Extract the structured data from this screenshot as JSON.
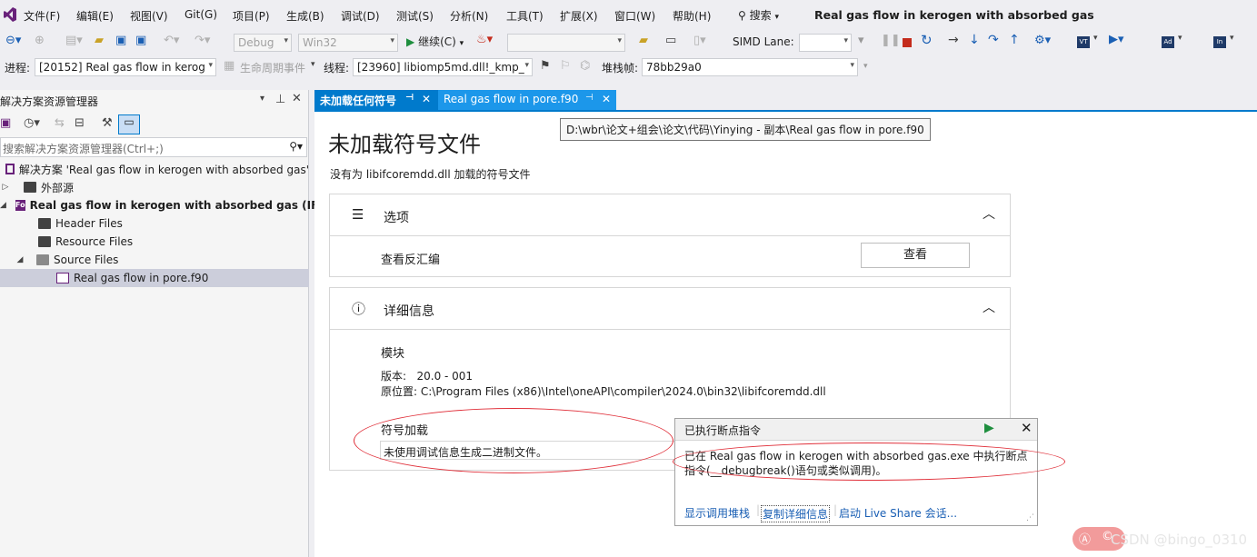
{
  "menu": {
    "items": [
      "文件(F)",
      "编辑(E)",
      "视图(V)",
      "Git(G)",
      "项目(P)",
      "生成(B)",
      "调试(D)",
      "测试(S)",
      "分析(N)",
      "工具(T)",
      "扩展(X)",
      "窗口(W)",
      "帮助(H)"
    ],
    "search_label": "搜索",
    "window_title": "Real gas flow in kerogen with absorbed gas"
  },
  "toolbar1": {
    "config": "Debug",
    "platform": "Win32",
    "continue_label": "继续(C)",
    "simd_label": "SIMD Lane:"
  },
  "toolbar2": {
    "process_label": "进程:",
    "process_value": "[20152] Real gas flow in kerog",
    "lifecycle_label": "生命周期事件",
    "thread_label": "线程:",
    "thread_value": "[23960] libiomp5md.dll!_kmp_",
    "stackframe_label": "堆栈帧:",
    "stackframe_value": "78bb29a0"
  },
  "solution_explorer": {
    "title": "解决方案资源管理器",
    "search_placeholder": "搜索解决方案资源管理器(Ctrl+;)",
    "items": [
      {
        "label": "解决方案 'Real gas flow in kerogen with absorbed gas'"
      },
      {
        "label": "外部源"
      },
      {
        "label": "Real gas flow in kerogen with absorbed gas (IFO"
      },
      {
        "label": "Header Files"
      },
      {
        "label": "Resource Files"
      },
      {
        "label": "Source Files"
      },
      {
        "label": "Real gas flow in pore.f90"
      }
    ]
  },
  "tabs": [
    {
      "label": "未加载任何符号"
    },
    {
      "label": "Real gas flow in pore.f90"
    }
  ],
  "tooltip": "D:\\wbr\\论文+组会\\论文\\代码\\Yinying - 副本\\Real gas flow in pore.f90",
  "document": {
    "title": "未加载符号文件",
    "subtitle": "没有为 libifcoremdd.dll 加载的符号文件",
    "options_title": "选项",
    "view_disasm_label": "查看反汇编",
    "view_button": "查看",
    "details_title": "详细信息",
    "module_label": "模块",
    "version_line": "版本:   20.0 - 001",
    "location_line": "原位置: C:\\Program Files (x86)\\Intel\\oneAPI\\compiler\\2024.0\\bin32\\libifcoremdd.dll",
    "symbol_load_label": "符号加载",
    "symbol_load_value": "未使用调试信息生成二进制文件。"
  },
  "popup": {
    "title": "已执行断点指令",
    "message_line1": "已在 Real gas flow in kerogen with absorbed gas.exe 中执行断点",
    "message_line2": "指令(__debugbreak()语句或类似调用)。",
    "links": [
      "显示调用堆栈",
      "复制详细信息",
      "启动 Live Share 会话..."
    ]
  },
  "watermark": "CSDN @bingo_0310",
  "colors": {
    "accent": "#007acc",
    "tab_active": "#007acc",
    "vs_purple": "#68217a",
    "annotation_red": "#e0303a",
    "green": "#1e8e3e",
    "stop_red": "#c42b1c"
  }
}
